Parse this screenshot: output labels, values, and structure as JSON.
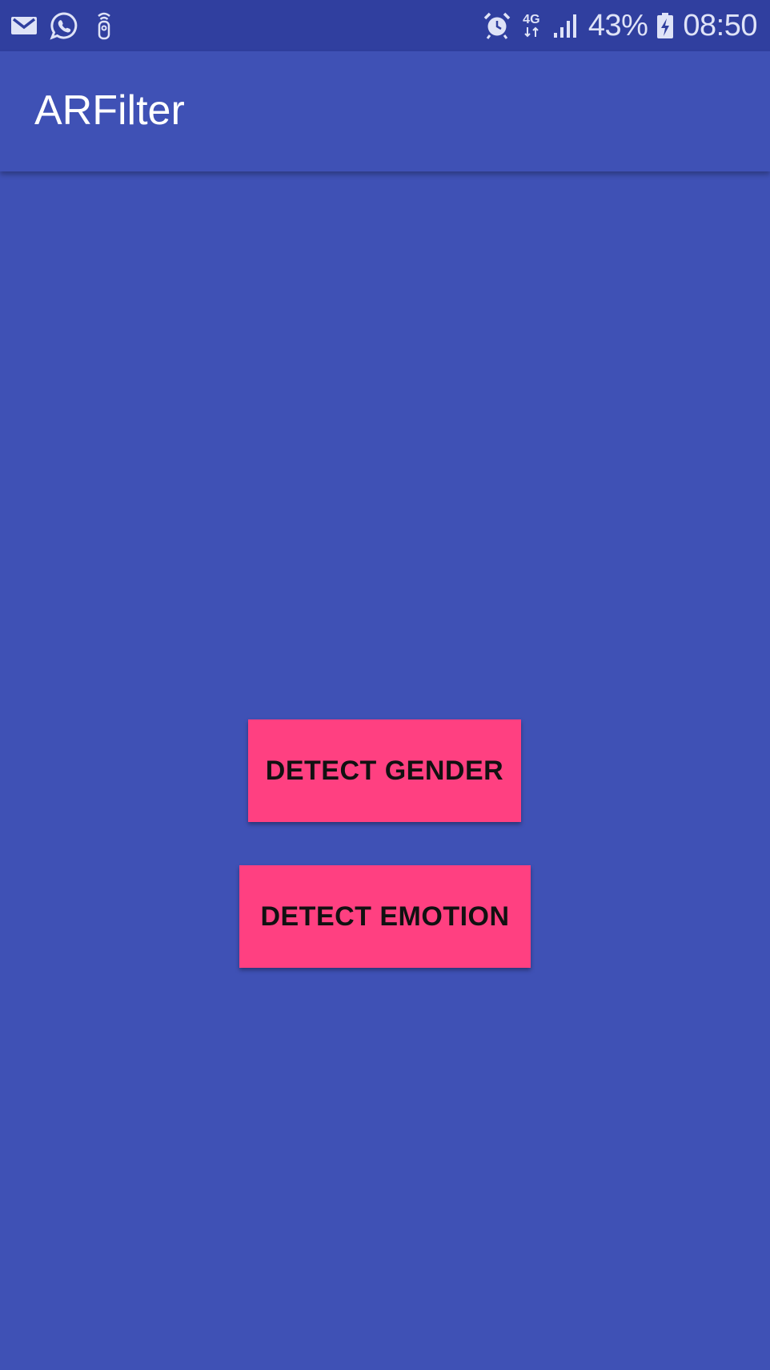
{
  "status_bar": {
    "left_icons": [
      "gmail-icon",
      "whatsapp-icon",
      "remote-icon"
    ],
    "network_type": "4G",
    "battery_percent": "43%",
    "time": "08:50",
    "icon_color": "#dfe3f7"
  },
  "app_bar": {
    "title": "ARFilter"
  },
  "buttons": {
    "detect_gender": "DETECT GENDER",
    "detect_emotion": "DETECT EMOTION"
  },
  "colors": {
    "primary": "#3F51B5",
    "primary_dark": "#303F9F",
    "accent": "#FF4081"
  }
}
